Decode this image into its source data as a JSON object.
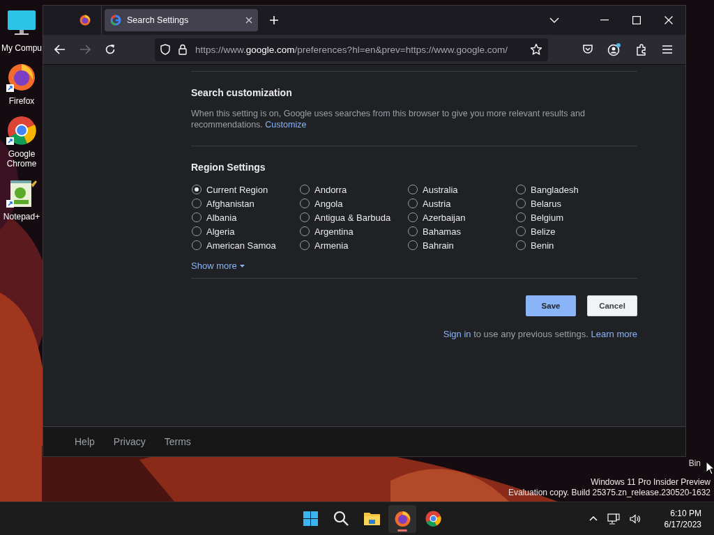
{
  "desktop": {
    "icons": [
      {
        "kind": "computer",
        "label": "My Compu",
        "shortcut": false
      },
      {
        "kind": "firefox",
        "label": "Firefox",
        "shortcut": true
      },
      {
        "kind": "chrome",
        "label": "Google Chrome",
        "shortcut": true
      },
      {
        "kind": "notepad",
        "label": "Notepad+",
        "shortcut": true
      }
    ],
    "recycle_label": "Bin",
    "watermark": [
      "Windows 11 Pro Insider Preview",
      "Evaluation copy. Build 25375.zn_release.230520-1632"
    ]
  },
  "browser": {
    "tabs": [
      {
        "kind": "pinned",
        "selected": false
      },
      {
        "kind": "page",
        "title": "Search Settings",
        "selected": true
      }
    ],
    "url": "https://www.**google.com**/preferences?hl=en&prev=https://www.google.com/",
    "forward_disabled": true,
    "account_notification": true,
    "page": {
      "customization": {
        "title": "Search customization",
        "text": "When this setting is on, Google uses searches from this browser to give you more relevant results and recommendations.",
        "link": "Customize"
      },
      "region": {
        "title": "Region Settings",
        "options": [
          {
            "label": "Current Region",
            "selected": true
          },
          {
            "label": "Afghanistan",
            "selected": false
          },
          {
            "label": "Albania",
            "selected": false
          },
          {
            "label": "Algeria",
            "selected": false
          },
          {
            "label": "American Samoa",
            "selected": false
          },
          {
            "label": "Andorra",
            "selected": false
          },
          {
            "label": "Angola",
            "selected": false
          },
          {
            "label": "Antigua & Barbuda",
            "selected": false
          },
          {
            "label": "Argentina",
            "selected": false
          },
          {
            "label": "Armenia",
            "selected": false
          },
          {
            "label": "Australia",
            "selected": false
          },
          {
            "label": "Austria",
            "selected": false
          },
          {
            "label": "Azerbaijan",
            "selected": false
          },
          {
            "label": "Bahamas",
            "selected": false
          },
          {
            "label": "Bahrain",
            "selected": false
          },
          {
            "label": "Bangladesh",
            "selected": false
          },
          {
            "label": "Belarus",
            "selected": false
          },
          {
            "label": "Belgium",
            "selected": false
          },
          {
            "label": "Belize",
            "selected": false
          },
          {
            "label": "Benin",
            "selected": false
          }
        ],
        "show_more": "Show more"
      },
      "buttons": [
        {
          "label": "Save",
          "kind": "primary"
        },
        {
          "label": "Cancel",
          "kind": "secondary"
        }
      ],
      "signin": {
        "link": "Sign in",
        "text": "to use any previous settings.",
        "learn_more": "Learn more"
      },
      "footer": [
        "Help",
        "Privacy",
        "Terms"
      ]
    }
  },
  "taskbar": {
    "apps": [
      {
        "kind": "start",
        "active": false
      },
      {
        "kind": "search",
        "active": false
      },
      {
        "kind": "files",
        "active": false
      },
      {
        "kind": "firefox",
        "active": true
      },
      {
        "kind": "chrome",
        "active": false
      }
    ],
    "time": "6:10 PM",
    "date": "6/17/2023"
  }
}
